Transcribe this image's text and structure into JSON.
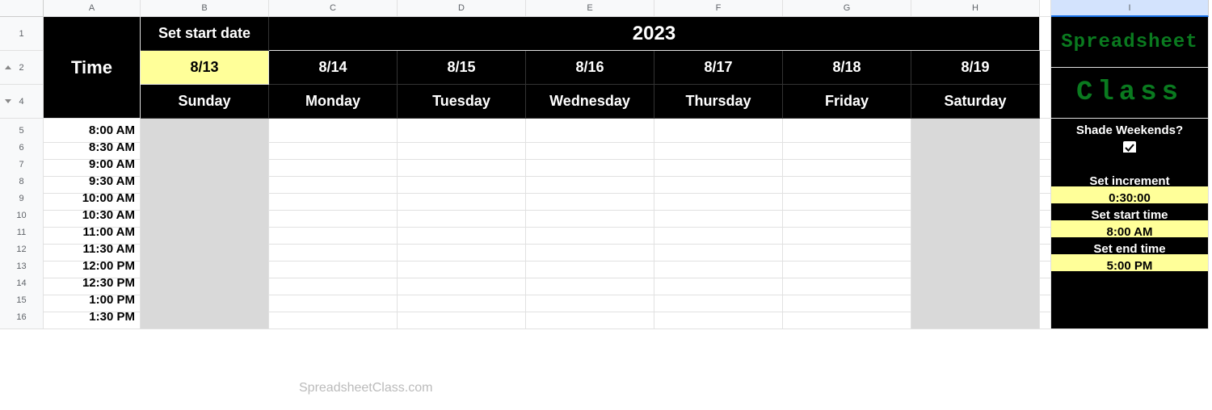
{
  "columns": [
    "A",
    "B",
    "C",
    "D",
    "E",
    "F",
    "G",
    "H",
    "I"
  ],
  "rows": [
    "1",
    "2",
    "4",
    "5",
    "6",
    "7",
    "8",
    "9",
    "10",
    "11",
    "12",
    "13",
    "14",
    "15",
    "16"
  ],
  "header": {
    "time_label": "Time",
    "set_start_date": "Set start date",
    "year": "2023",
    "start_date_value": "8/13",
    "dates": [
      "8/14",
      "8/15",
      "8/16",
      "8/17",
      "8/18",
      "8/19"
    ],
    "days": [
      "Sunday",
      "Monday",
      "Tuesday",
      "Wednesday",
      "Thursday",
      "Friday",
      "Saturday"
    ]
  },
  "times": [
    "8:00 AM",
    "8:30 AM",
    "9:00 AM",
    "9:30 AM",
    "10:00 AM",
    "10:30 AM",
    "11:00 AM",
    "11:30 AM",
    "12:00 PM",
    "12:30 PM",
    "1:00 PM",
    "1:30 PM"
  ],
  "sidebar": {
    "logo_top": "Spreadsheet",
    "logo_bottom": "Class",
    "shade_label": "Shade Weekends?",
    "shade_checked": true,
    "increment_label": "Set increment",
    "increment_value": "0:30:00",
    "start_time_label": "Set start time",
    "start_time_value": "8:00 AM",
    "end_time_label": "Set end time",
    "end_time_value": "5:00 PM"
  },
  "watermark": "SpreadsheetClass.com",
  "chart_data": {
    "type": "table",
    "title": "Weekly schedule template",
    "year": 2023,
    "start_date": "8/13",
    "increment": "0:30:00",
    "start_time": "8:00 AM",
    "end_time": "5:00 PM",
    "days": [
      "Sunday",
      "Monday",
      "Tuesday",
      "Wednesday",
      "Thursday",
      "Friday",
      "Saturday"
    ],
    "dates": [
      "8/13",
      "8/14",
      "8/15",
      "8/16",
      "8/17",
      "8/18",
      "8/19"
    ],
    "time_slots": [
      "8:00 AM",
      "8:30 AM",
      "9:00 AM",
      "9:30 AM",
      "10:00 AM",
      "10:30 AM",
      "11:00 AM",
      "11:30 AM",
      "12:00 PM",
      "12:30 PM",
      "1:00 PM",
      "1:30 PM"
    ],
    "weekend_columns": [
      "Sunday",
      "Saturday"
    ],
    "shade_weekends": true,
    "body_values": []
  }
}
